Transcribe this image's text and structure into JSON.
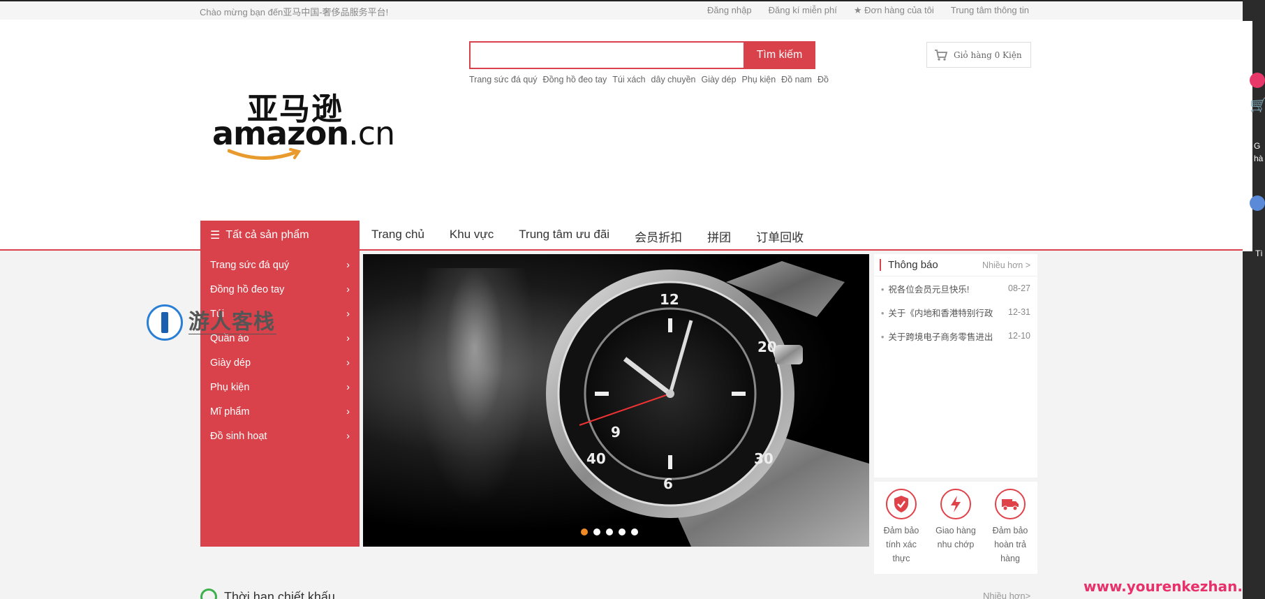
{
  "topbar": {
    "welcome": "Chào mừng bạn đến亚马中国-奢侈品服务平台!",
    "links": [
      "Đăng nhập",
      "Đăng kí miễn phí",
      "★ Đơn hàng của tôi",
      "Trung tâm thông tin"
    ]
  },
  "logo": {
    "cn": "亚马逊",
    "en": "amazon",
    "en_suffix": ".cn"
  },
  "search": {
    "value": "",
    "button": "Tìm kiếm"
  },
  "hot_words": [
    "Trang sức đá quý",
    "Đồng hồ đeo tay",
    "Túi xách",
    "dây chuyền",
    "Giày dép",
    "Phụ kiện",
    "Đồ nam",
    "Đồ"
  ],
  "cart": {
    "label": "Giỏ hàng 0 Kiện"
  },
  "nav": {
    "all_products": "Tất cả sản phẩm",
    "items": [
      "Trang chủ",
      "Khu vực",
      "Trung tâm ưu đãi",
      "会员折扣",
      "拼团",
      "订单回收"
    ]
  },
  "categories": [
    "Trang sức đá quý",
    "Đồng hồ đeo tay",
    "Túi",
    "Quần áo",
    "Giày dép",
    "Phụ kiện",
    "Mĩ phẩm",
    "Đồ sinh hoạt"
  ],
  "watermark": {
    "title": "游人客栈"
  },
  "banner": {
    "dots": 5,
    "active_dot": 0
  },
  "notice": {
    "title": "Thông báo",
    "more": "Nhiều hơn >",
    "rows": [
      {
        "text": "祝各位会员元旦快乐!",
        "date": "08-27"
      },
      {
        "text": "关于《内地和香港特别行政",
        "date": "12-31"
      },
      {
        "text": "关于跨境电子商务零售进出",
        "date": "12-10"
      }
    ]
  },
  "services": [
    {
      "label": "Đảm bảo tính xác thực",
      "icon": "shield-icon"
    },
    {
      "label": "Giao hàng nhu chớp",
      "icon": "lightning-icon"
    },
    {
      "label": "Đảm bảo hoàn trả hàng",
      "icon": "truck-icon"
    }
  ],
  "bottom": {
    "title": "Thời hạn chiết khấu",
    "more": "Nhiều hơn>"
  },
  "site_watermark": "www.yourenkezhan.com",
  "right_strip": {
    "text": "G hà",
    "text2": "Tì"
  },
  "colors": {
    "accent": "#d9424a",
    "orange_dot": "#f08a24"
  }
}
